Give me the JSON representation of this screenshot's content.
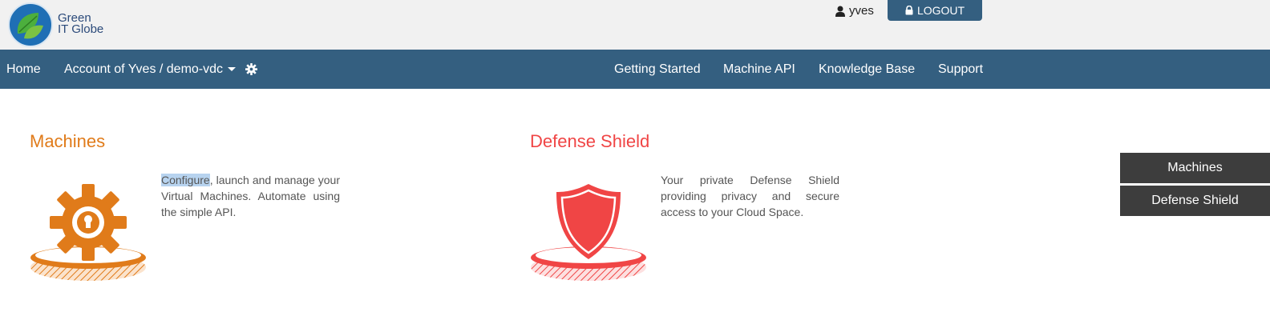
{
  "brand": {
    "line1": "Green",
    "line2": "IT Globe",
    "icon": "globe-leaf-logo"
  },
  "user": {
    "name": "yves",
    "icon": "user-icon"
  },
  "logout": {
    "label": "LOGOUT",
    "icon": "lock-icon"
  },
  "nav": {
    "home": "Home",
    "account": "Account of Yves / demo-vdc",
    "settings_icon": "gear-icon",
    "right": [
      "Getting Started",
      "Machine API",
      "Knowledge Base",
      "Support"
    ]
  },
  "sections": {
    "machines": {
      "title": "Machines",
      "desc_highlight": "Configure",
      "desc_rest": ", launch and manage your Virtual Machines. Automate using the simple API.",
      "icon": "gear-platform-icon",
      "color": "#e07b1a"
    },
    "defense": {
      "title": "Defense Shield",
      "desc": "Your private Defense Shield providing privacy and secure access to your Cloud Space.",
      "icon": "shield-platform-icon",
      "color": "#f04545"
    }
  },
  "side": [
    "Machines",
    "Defense Shield"
  ],
  "colors": {
    "navbar": "#345f80",
    "topbar": "#f1f1f1",
    "side_button": "#3d3d3d"
  }
}
